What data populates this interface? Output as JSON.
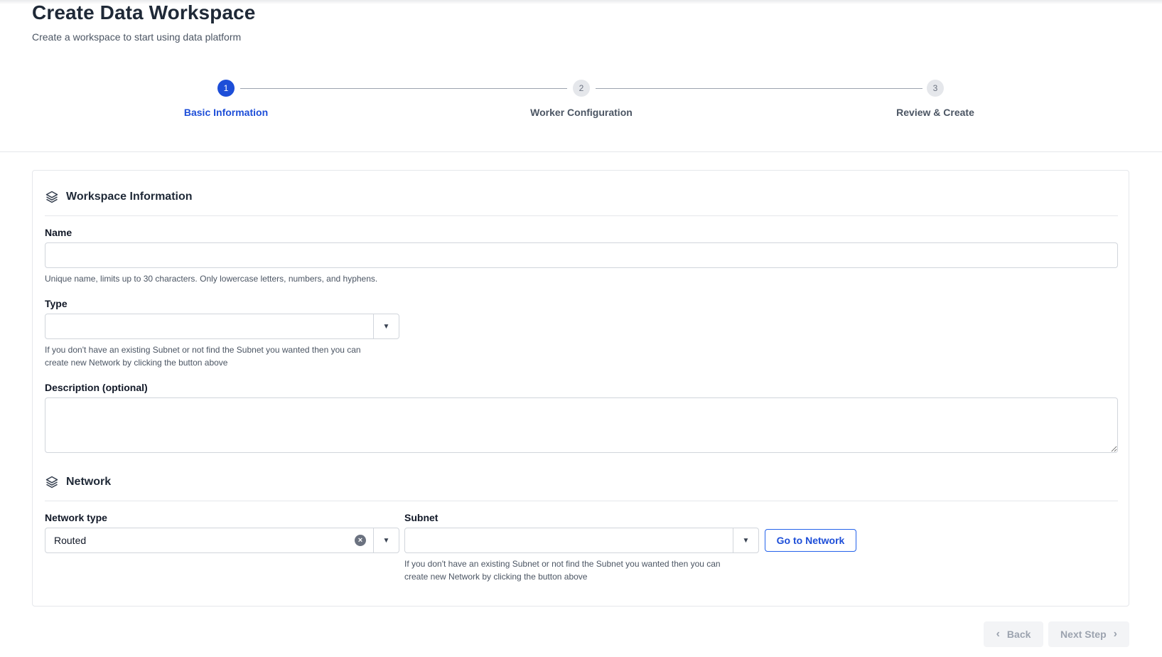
{
  "header": {
    "title": "Create Data Workspace",
    "subtitle": "Create a workspace to start using data platform"
  },
  "stepper": {
    "steps": [
      {
        "number": "1",
        "label": "Basic Information",
        "state": "active"
      },
      {
        "number": "2",
        "label": "Worker Configuration",
        "state": "inactive"
      },
      {
        "number": "3",
        "label": "Review & Create",
        "state": "inactive"
      }
    ]
  },
  "workspace_section": {
    "title": "Workspace Information",
    "icon": "layers-icon",
    "name_field": {
      "label": "Name",
      "value": "",
      "help": "Unique name, limits up to 30 characters. Only lowercase letters, numbers, and hyphens."
    },
    "type_field": {
      "label": "Type",
      "value": "",
      "help_line1": "If you don't have an existing Subnet or not find the Subnet you wanted then you can",
      "help_line2": "create new Network by clicking the button above"
    },
    "description_field": {
      "label": "Description (optional)",
      "value": ""
    }
  },
  "network_section": {
    "title": "Network",
    "icon": "layers-icon",
    "network_type": {
      "label": "Network type",
      "value": "Routed",
      "clear_icon": "clear-icon"
    },
    "subnet": {
      "label": "Subnet",
      "value": "",
      "help_line1": "If you don't have an existing Subnet or not find the Subnet you wanted then you can",
      "help_line2": "create new Network by clicking the button above"
    },
    "go_to_network_label": "Go to Network"
  },
  "footer": {
    "back_label": "Back",
    "next_label": "Next Step"
  },
  "colors": {
    "accent": "#1d4ed8",
    "border": "#d1d5db",
    "muted": "#4b5563"
  }
}
